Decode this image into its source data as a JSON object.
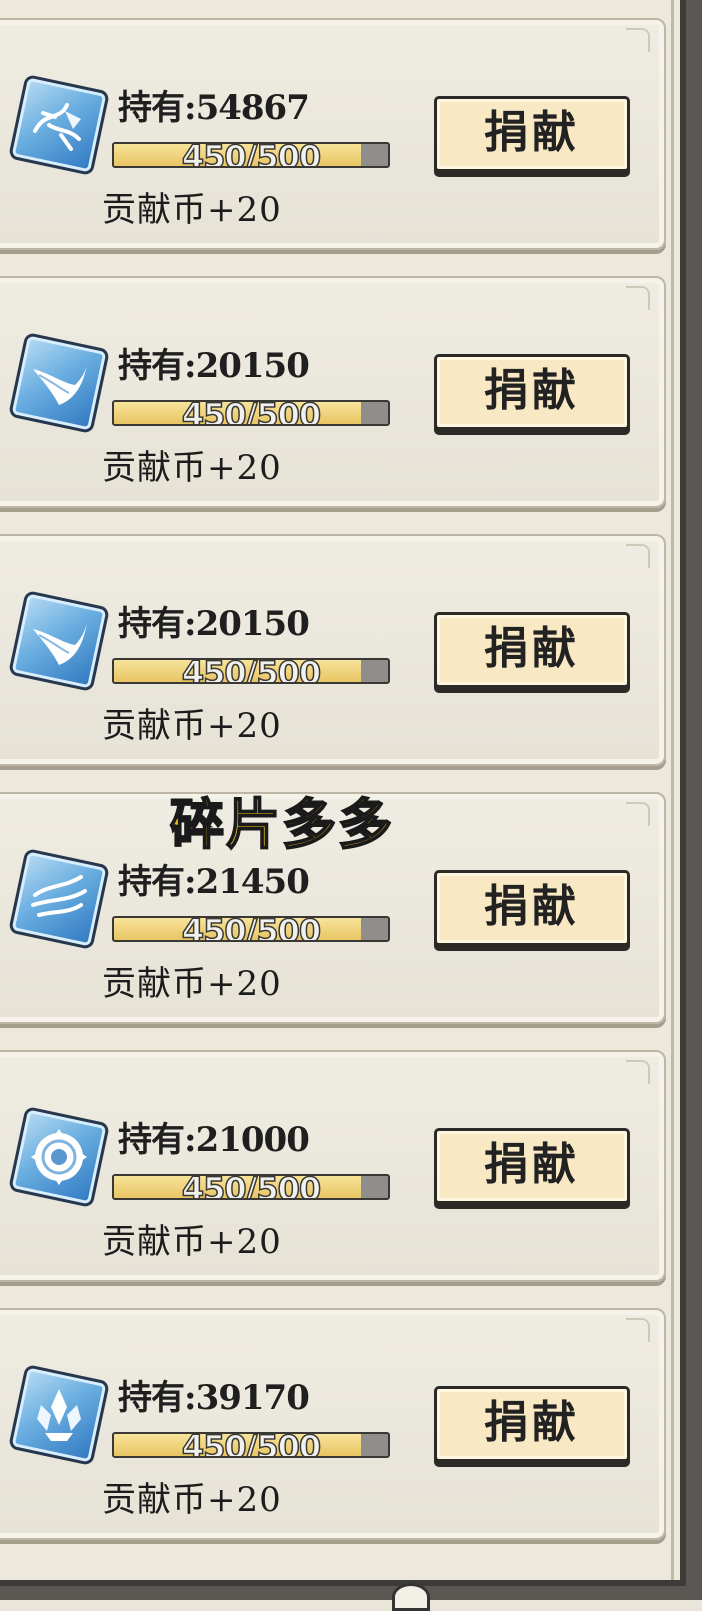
{
  "items": [
    {
      "hold_label": "持有:",
      "hold_value": "54867",
      "progress_text": "450/500",
      "progress": 0.9,
      "reward": "贡献币+20",
      "button": "捐献",
      "icon": "scroll-fragment-icon"
    },
    {
      "hold_label": "持有:",
      "hold_value": "20150",
      "progress_text": "450/500",
      "progress": 0.9,
      "reward": "贡献币+20",
      "button": "捐献",
      "icon": "white-blade-icon"
    },
    {
      "hold_label": "持有:",
      "hold_value": "20150",
      "progress_text": "450/500",
      "progress": 0.9,
      "reward": "贡献币+20",
      "button": "捐献",
      "icon": "white-blade-icon"
    },
    {
      "hold_label": "持有:",
      "hold_value": "21450",
      "progress_text": "450/500",
      "progress": 0.9,
      "reward": "贡献币+20",
      "button": "捐献",
      "icon": "wind-slash-icon"
    },
    {
      "hold_label": "持有:",
      "hold_value": "21000",
      "progress_text": "450/500",
      "progress": 0.9,
      "reward": "贡献币+20",
      "button": "捐献",
      "icon": "saw-ring-icon"
    },
    {
      "hold_label": "持有:",
      "hold_value": "39170",
      "progress_text": "450/500",
      "progress": 0.9,
      "reward": "贡献币+20",
      "button": "捐献",
      "icon": "crystal-cluster-icon"
    }
  ],
  "overlay_text": "碎片多多",
  "colors": {
    "button_bg": "#f8e8c4",
    "progress_fill": "#e8c563",
    "overlay_text": "#f2c21b",
    "icon_blue": "#6aaee0"
  }
}
